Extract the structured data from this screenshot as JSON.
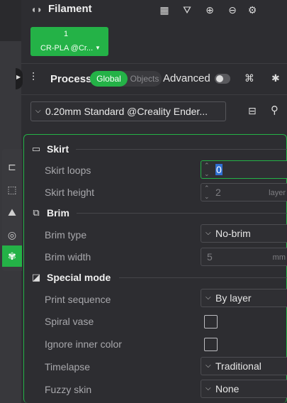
{
  "filament": {
    "title": "Filament",
    "card_index": "1",
    "card_name": "CR-PLA @Cr...",
    "icons": [
      "printer-sync-icon",
      "spray-icon",
      "add-icon",
      "remove-icon",
      "settings-icon"
    ]
  },
  "process": {
    "title": "Process",
    "global_label": "Global",
    "objects_label": "Objects",
    "advanced_label": "Advanced",
    "advanced_enabled": false,
    "preset": "0.20mm Standard @Creality Ender..."
  },
  "sections": {
    "skirt": {
      "title": "Skirt",
      "loops_label": "Skirt loops",
      "loops_value": "0",
      "height_label": "Skirt height",
      "height_value": "2",
      "height_unit": "layer"
    },
    "brim": {
      "title": "Brim",
      "type_label": "Brim type",
      "type_value": "No-brim",
      "width_label": "Brim width",
      "width_value": "5",
      "width_unit": "mm"
    },
    "special": {
      "title": "Special mode",
      "print_sequence_label": "Print sequence",
      "print_sequence_value": "By layer",
      "spiral_vase_label": "Spiral vase",
      "spiral_vase_checked": false,
      "ignore_inner_label": "Ignore inner color",
      "ignore_inner_checked": false,
      "timelapse_label": "Timelapse",
      "timelapse_value": "Traditional",
      "fuzzy_label": "Fuzzy skin",
      "fuzzy_value": "None"
    }
  },
  "colors": {
    "accent": "#24b247",
    "background": "#2d2d31"
  }
}
